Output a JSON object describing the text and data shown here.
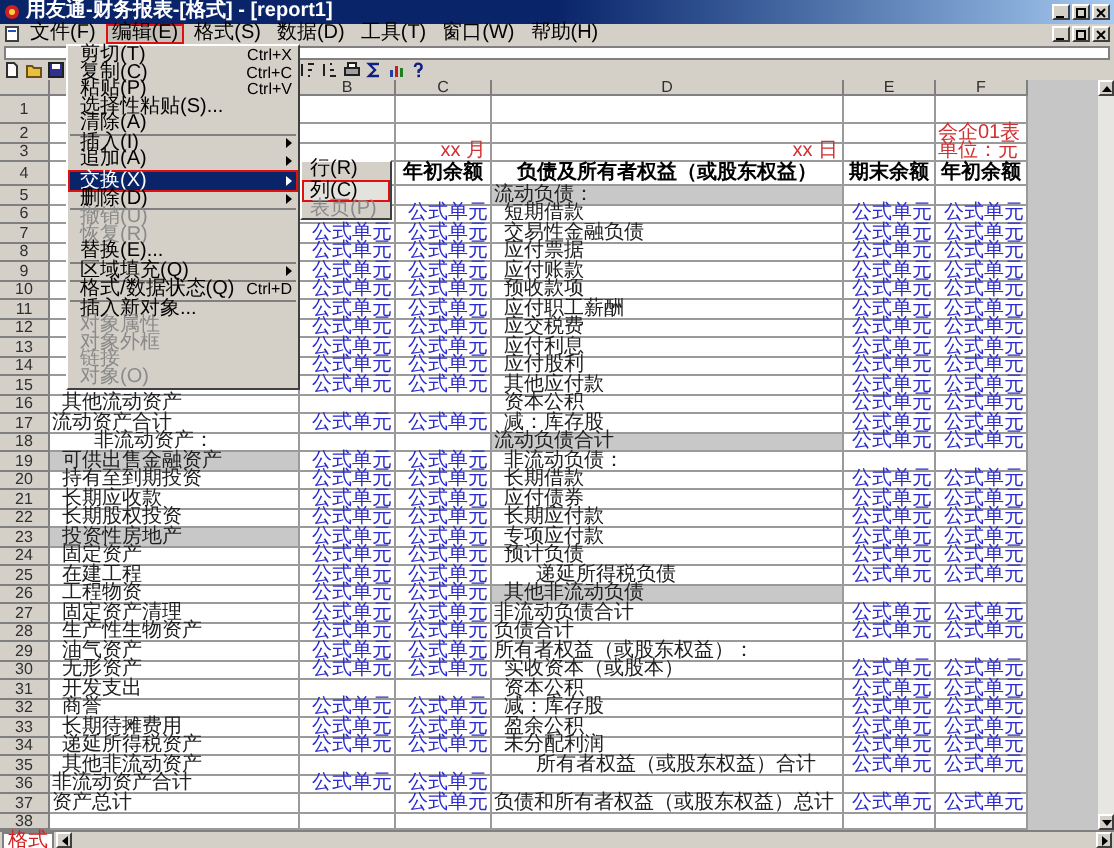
{
  "window": {
    "title": "用友通-财务报表-[格式] - [report1]"
  },
  "menu_bar": [
    {
      "label": "文件(F)",
      "selected": false
    },
    {
      "label": "编辑(E)",
      "selected": true
    },
    {
      "label": "格式(S)",
      "selected": false
    },
    {
      "label": "数据(D)",
      "selected": false
    },
    {
      "label": "工具(T)",
      "selected": false
    },
    {
      "label": "窗口(W)",
      "selected": false
    },
    {
      "label": "帮助(H)",
      "selected": false
    }
  ],
  "edit_menu": {
    "items": [
      {
        "kind": "item",
        "label": "剪切(T)",
        "shortcut": "Ctrl+X",
        "disabled": false,
        "has_submenu": false,
        "selected": false
      },
      {
        "kind": "item",
        "label": "复制(C)",
        "shortcut": "Ctrl+C",
        "disabled": false,
        "has_submenu": false,
        "selected": false
      },
      {
        "kind": "item",
        "label": "粘贴(P)",
        "shortcut": "Ctrl+V",
        "disabled": false,
        "has_submenu": false,
        "selected": false
      },
      {
        "kind": "item",
        "label": "选择性粘贴(S)...",
        "disabled": false,
        "has_submenu": false,
        "selected": false
      },
      {
        "kind": "item",
        "label": "清除(A)",
        "disabled": false,
        "has_submenu": false,
        "selected": false
      },
      {
        "kind": "separator"
      },
      {
        "kind": "item",
        "label": "插入(I)",
        "disabled": false,
        "has_submenu": true,
        "selected": false
      },
      {
        "kind": "item",
        "label": "追加(A)",
        "disabled": false,
        "has_submenu": true,
        "selected": false
      },
      {
        "kind": "item",
        "label": "交换(X)",
        "disabled": false,
        "has_submenu": true,
        "selected": true
      },
      {
        "kind": "item",
        "label": "删除(D)",
        "disabled": false,
        "has_submenu": true,
        "selected": false
      },
      {
        "kind": "separator"
      },
      {
        "kind": "item",
        "label": "撤销(U)",
        "disabled": true,
        "has_submenu": false,
        "selected": false
      },
      {
        "kind": "item",
        "label": "恢复(R)",
        "disabled": true,
        "has_submenu": false,
        "selected": false
      },
      {
        "kind": "item",
        "label": "替换(E)...",
        "disabled": false,
        "has_submenu": false,
        "selected": false
      },
      {
        "kind": "separator"
      },
      {
        "kind": "item",
        "label": "区域填充(Q)",
        "disabled": false,
        "has_submenu": true,
        "selected": false
      },
      {
        "kind": "separator"
      },
      {
        "kind": "item",
        "label": "格式/数据状态(Q)",
        "shortcut": "Ctrl+D",
        "disabled": false,
        "has_submenu": false,
        "selected": false
      },
      {
        "kind": "separator"
      },
      {
        "kind": "item",
        "label": "插入新对象...",
        "disabled": false,
        "has_submenu": false,
        "selected": false
      },
      {
        "kind": "item",
        "label": "对象属性",
        "disabled": true,
        "has_submenu": false,
        "selected": false
      },
      {
        "kind": "item",
        "label": "对象外框",
        "disabled": true,
        "has_submenu": false,
        "selected": false
      },
      {
        "kind": "item",
        "label": "链接",
        "disabled": true,
        "has_submenu": false,
        "selected": false
      },
      {
        "kind": "item",
        "label": "对象(O)",
        "disabled": true,
        "has_submenu": false,
        "selected": false
      }
    ]
  },
  "submenu": {
    "items": [
      {
        "label": "行(R)",
        "disabled": false,
        "selected": false
      },
      {
        "label": "列(C)",
        "disabled": false,
        "selected": true
      },
      {
        "label": "表页(P)",
        "disabled": true,
        "selected": false
      }
    ]
  },
  "sheet": {
    "columns": [
      "B",
      "C",
      "D",
      "E",
      "F"
    ],
    "rows": [
      {
        "number": "1"
      },
      {
        "number": "2",
        "f": {
          "text": "会企01表",
          "kind": "note"
        }
      },
      {
        "number": "3",
        "c": {
          "text": "xx 月",
          "kind": "note-right"
        },
        "d": {
          "text": "xx 日",
          "kind": "note-right"
        },
        "f": {
          "text": "单位：元",
          "kind": "note"
        }
      },
      {
        "number": "4",
        "c": {
          "text": "年初余额",
          "kind": "header"
        },
        "d": {
          "text": "负债及所有者权益（或股东权益）",
          "kind": "header"
        },
        "e": {
          "text": "期末余额",
          "kind": "header"
        },
        "f": {
          "text": "年初余额",
          "kind": "header"
        }
      },
      {
        "number": "5",
        "d": {
          "text": "流动负债：",
          "kind": "total",
          "shaded": true
        }
      },
      {
        "number": "6",
        "c": {
          "text": "公式单元",
          "kind": "formula"
        },
        "d": {
          "text": "短期借款",
          "kind": "label"
        },
        "e": {
          "text": "公式单元",
          "kind": "formula"
        },
        "f": {
          "text": "公式单元",
          "kind": "formula"
        }
      },
      {
        "number": "7",
        "b": {
          "text": "公式单元",
          "kind": "formula"
        },
        "c": {
          "text": "公式单元",
          "kind": "formula"
        },
        "d": {
          "text": "交易性金融负债",
          "kind": "label"
        },
        "e": {
          "text": "公式单元",
          "kind": "formula"
        },
        "f": {
          "text": "公式单元",
          "kind": "formula"
        }
      },
      {
        "number": "8",
        "b": {
          "text": "公式单元",
          "kind": "formula"
        },
        "c": {
          "text": "公式单元",
          "kind": "formula"
        },
        "d": {
          "text": "应付票据",
          "kind": "label"
        },
        "e": {
          "text": "公式单元",
          "kind": "formula"
        },
        "f": {
          "text": "公式单元",
          "kind": "formula"
        }
      },
      {
        "number": "9",
        "b": {
          "text": "公式单元",
          "kind": "formula"
        },
        "c": {
          "text": "公式单元",
          "kind": "formula"
        },
        "d": {
          "text": "应付账款",
          "kind": "label"
        },
        "e": {
          "text": "公式单元",
          "kind": "formula"
        },
        "f": {
          "text": "公式单元",
          "kind": "formula"
        }
      },
      {
        "number": "10",
        "b": {
          "text": "公式单元",
          "kind": "formula"
        },
        "c": {
          "text": "公式单元",
          "kind": "formula"
        },
        "d": {
          "text": "预收款项",
          "kind": "label"
        },
        "e": {
          "text": "公式单元",
          "kind": "formula"
        },
        "f": {
          "text": "公式单元",
          "kind": "formula"
        }
      },
      {
        "number": "11",
        "b": {
          "text": "公式单元",
          "kind": "formula"
        },
        "c": {
          "text": "公式单元",
          "kind": "formula"
        },
        "d": {
          "text": "应付职工薪酬",
          "kind": "label"
        },
        "e": {
          "text": "公式单元",
          "kind": "formula"
        },
        "f": {
          "text": "公式单元",
          "kind": "formula"
        }
      },
      {
        "number": "12",
        "b": {
          "text": "公式单元",
          "kind": "formula"
        },
        "c": {
          "text": "公式单元",
          "kind": "formula"
        },
        "d": {
          "text": "应交税费",
          "kind": "label"
        },
        "e": {
          "text": "公式单元",
          "kind": "formula"
        },
        "f": {
          "text": "公式单元",
          "kind": "formula"
        }
      },
      {
        "number": "13",
        "b": {
          "text": "公式单元",
          "kind": "formula"
        },
        "c": {
          "text": "公式单元",
          "kind": "formula"
        },
        "d": {
          "text": "应付利息",
          "kind": "label"
        },
        "e": {
          "text": "公式单元",
          "kind": "formula"
        },
        "f": {
          "text": "公式单元",
          "kind": "formula"
        }
      },
      {
        "number": "14",
        "b": {
          "text": "公式单元",
          "kind": "formula"
        },
        "c": {
          "text": "公式单元",
          "kind": "formula"
        },
        "d": {
          "text": "应付股利",
          "kind": "label"
        },
        "e": {
          "text": "公式单元",
          "kind": "formula"
        },
        "f": {
          "text": "公式单元",
          "kind": "formula"
        }
      },
      {
        "number": "15",
        "b": {
          "text": "公式单元",
          "kind": "formula"
        },
        "c": {
          "text": "公式单元",
          "kind": "formula"
        },
        "d": {
          "text": "其他应付款",
          "kind": "label"
        },
        "e": {
          "text": "公式单元",
          "kind": "formula"
        },
        "f": {
          "text": "公式单元",
          "kind": "formula"
        }
      },
      {
        "number": "16",
        "a": {
          "text": "其他流动资产",
          "kind": "label"
        },
        "d": {
          "text": "资本公积",
          "kind": "label"
        },
        "e": {
          "text": "公式单元",
          "kind": "formula"
        },
        "f": {
          "text": "公式单元",
          "kind": "formula"
        }
      },
      {
        "number": "17",
        "a": {
          "text": "流动资产合计",
          "kind": "total"
        },
        "b": {
          "text": "公式单元",
          "kind": "formula"
        },
        "c": {
          "text": "公式单元",
          "kind": "formula"
        },
        "d": {
          "text": "减：库存股",
          "kind": "label"
        },
        "e": {
          "text": "公式单元",
          "kind": "formula"
        },
        "f": {
          "text": "公式单元",
          "kind": "formula"
        }
      },
      {
        "number": "18",
        "a": {
          "text": "非流动资产：",
          "kind": "indented"
        },
        "d": {
          "text": "流动负债合计",
          "kind": "total",
          "shaded": true
        },
        "e": {
          "text": "公式单元",
          "kind": "formula"
        },
        "f": {
          "text": "公式单元",
          "kind": "formula"
        }
      },
      {
        "number": "19",
        "a": {
          "text": "可供出售金融资产",
          "kind": "label",
          "shaded": true
        },
        "b": {
          "text": "公式单元",
          "kind": "formula"
        },
        "c": {
          "text": "公式单元",
          "kind": "formula"
        },
        "d": {
          "text": "非流动负债：",
          "kind": "label"
        }
      },
      {
        "number": "20",
        "a": {
          "text": "持有至到期投资",
          "kind": "label"
        },
        "b": {
          "text": "公式单元",
          "kind": "formula"
        },
        "c": {
          "text": "公式单元",
          "kind": "formula"
        },
        "d": {
          "text": "长期借款",
          "kind": "label"
        },
        "e": {
          "text": "公式单元",
          "kind": "formula"
        },
        "f": {
          "text": "公式单元",
          "kind": "formula"
        }
      },
      {
        "number": "21",
        "a": {
          "text": "长期应收款",
          "kind": "label"
        },
        "b": {
          "text": "公式单元",
          "kind": "formula"
        },
        "c": {
          "text": "公式单元",
          "kind": "formula"
        },
        "d": {
          "text": "应付债券",
          "kind": "label"
        },
        "e": {
          "text": "公式单元",
          "kind": "formula"
        },
        "f": {
          "text": "公式单元",
          "kind": "formula"
        }
      },
      {
        "number": "22",
        "a": {
          "text": "长期股权投资",
          "kind": "label"
        },
        "b": {
          "text": "公式单元",
          "kind": "formula"
        },
        "c": {
          "text": "公式单元",
          "kind": "formula"
        },
        "d": {
          "text": "长期应付款",
          "kind": "label"
        },
        "e": {
          "text": "公式单元",
          "kind": "formula"
        },
        "f": {
          "text": "公式单元",
          "kind": "formula"
        }
      },
      {
        "number": "23",
        "a": {
          "text": "投资性房地产",
          "kind": "label",
          "shaded": true
        },
        "b": {
          "text": "公式单元",
          "kind": "formula"
        },
        "c": {
          "text": "公式单元",
          "kind": "formula"
        },
        "d": {
          "text": "专项应付款",
          "kind": "label"
        },
        "e": {
          "text": "公式单元",
          "kind": "formula"
        },
        "f": {
          "text": "公式单元",
          "kind": "formula"
        }
      },
      {
        "number": "24",
        "a": {
          "text": "固定资产",
          "kind": "label"
        },
        "b": {
          "text": "公式单元",
          "kind": "formula"
        },
        "c": {
          "text": "公式单元",
          "kind": "formula"
        },
        "d": {
          "text": "预计负债",
          "kind": "label"
        },
        "e": {
          "text": "公式单元",
          "kind": "formula"
        },
        "f": {
          "text": "公式单元",
          "kind": "formula"
        }
      },
      {
        "number": "25",
        "a": {
          "text": "在建工程",
          "kind": "label"
        },
        "b": {
          "text": "公式单元",
          "kind": "formula"
        },
        "c": {
          "text": "公式单元",
          "kind": "formula"
        },
        "d": {
          "text": "递延所得税负债",
          "kind": "indented"
        },
        "e": {
          "text": "公式单元",
          "kind": "formula"
        },
        "f": {
          "text": "公式单元",
          "kind": "formula"
        }
      },
      {
        "number": "26",
        "a": {
          "text": "工程物资",
          "kind": "label"
        },
        "b": {
          "text": "公式单元",
          "kind": "formula"
        },
        "c": {
          "text": "公式单元",
          "kind": "formula"
        },
        "d": {
          "text": "其他非流动负债",
          "kind": "label",
          "shaded": true
        }
      },
      {
        "number": "27",
        "a": {
          "text": "固定资产清理",
          "kind": "label"
        },
        "b": {
          "text": "公式单元",
          "kind": "formula"
        },
        "c": {
          "text": "公式单元",
          "kind": "formula"
        },
        "d": {
          "text": "非流动负债合计",
          "kind": "total"
        },
        "e": {
          "text": "公式单元",
          "kind": "formula"
        },
        "f": {
          "text": "公式单元",
          "kind": "formula"
        }
      },
      {
        "number": "28",
        "a": {
          "text": "生产性生物资产",
          "kind": "label"
        },
        "b": {
          "text": "公式单元",
          "kind": "formula"
        },
        "c": {
          "text": "公式单元",
          "kind": "formula"
        },
        "d": {
          "text": "负债合计",
          "kind": "total"
        },
        "e": {
          "text": "公式单元",
          "kind": "formula"
        },
        "f": {
          "text": "公式单元",
          "kind": "formula"
        }
      },
      {
        "number": "29",
        "a": {
          "text": "油气资产",
          "kind": "label"
        },
        "b": {
          "text": "公式单元",
          "kind": "formula"
        },
        "c": {
          "text": "公式单元",
          "kind": "formula"
        },
        "d": {
          "text": "所有者权益（或股东权益）：",
          "kind": "total"
        }
      },
      {
        "number": "30",
        "a": {
          "text": "无形资产",
          "kind": "label"
        },
        "b": {
          "text": "公式单元",
          "kind": "formula"
        },
        "c": {
          "text": "公式单元",
          "kind": "formula"
        },
        "d": {
          "text": "实收资本（或股本）",
          "kind": "label"
        },
        "e": {
          "text": "公式单元",
          "kind": "formula"
        },
        "f": {
          "text": "公式单元",
          "kind": "formula"
        }
      },
      {
        "number": "31",
        "a": {
          "text": "开发支出",
          "kind": "label"
        },
        "d": {
          "text": "资本公积",
          "kind": "label"
        },
        "e": {
          "text": "公式单元",
          "kind": "formula"
        },
        "f": {
          "text": "公式单元",
          "kind": "formula"
        }
      },
      {
        "number": "32",
        "a": {
          "text": "商誉",
          "kind": "label"
        },
        "b": {
          "text": "公式单元",
          "kind": "formula"
        },
        "c": {
          "text": "公式单元",
          "kind": "formula"
        },
        "d": {
          "text": "减：库存股",
          "kind": "label"
        },
        "e": {
          "text": "公式单元",
          "kind": "formula"
        },
        "f": {
          "text": "公式单元",
          "kind": "formula"
        }
      },
      {
        "number": "33",
        "a": {
          "text": "长期待摊费用",
          "kind": "label"
        },
        "b": {
          "text": "公式单元",
          "kind": "formula"
        },
        "c": {
          "text": "公式单元",
          "kind": "formula"
        },
        "d": {
          "text": "盈余公积",
          "kind": "label"
        },
        "e": {
          "text": "公式单元",
          "kind": "formula"
        },
        "f": {
          "text": "公式单元",
          "kind": "formula"
        }
      },
      {
        "number": "34",
        "a": {
          "text": "递延所得税资产",
          "kind": "label"
        },
        "b": {
          "text": "公式单元",
          "kind": "formula"
        },
        "c": {
          "text": "公式单元",
          "kind": "formula"
        },
        "d": {
          "text": "未分配利润",
          "kind": "label"
        },
        "e": {
          "text": "公式单元",
          "kind": "formula"
        },
        "f": {
          "text": "公式单元",
          "kind": "formula"
        }
      },
      {
        "number": "35",
        "a": {
          "text": "其他非流动资产",
          "kind": "label"
        },
        "d": {
          "text": "所有者权益（或股东权益）合计",
          "kind": "indented"
        },
        "e": {
          "text": "公式单元",
          "kind": "formula"
        },
        "f": {
          "text": "公式单元",
          "kind": "formula"
        }
      },
      {
        "number": "36",
        "a": {
          "text": "非流动资产合计",
          "kind": "total"
        },
        "b": {
          "text": "公式单元",
          "kind": "formula"
        },
        "c": {
          "text": "公式单元",
          "kind": "formula"
        }
      },
      {
        "number": "37",
        "a": {
          "text": "资产总计",
          "kind": "total"
        },
        "c": {
          "text": "公式单元",
          "kind": "formula"
        },
        "d": {
          "text": "负债和所有者权益（或股东权益）总计",
          "kind": "total"
        },
        "e": {
          "text": "公式单元",
          "kind": "formula"
        },
        "f": {
          "text": "公式单元",
          "kind": "formula"
        }
      },
      {
        "number": "38"
      }
    ]
  },
  "sheet_tabs": [
    {
      "label": "格式",
      "selected": true
    }
  ]
}
